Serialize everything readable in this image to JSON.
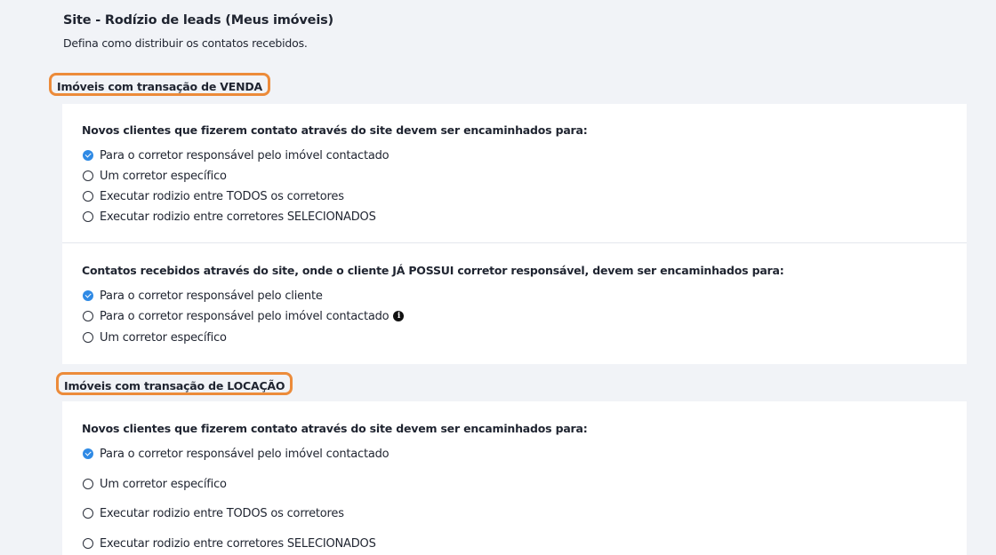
{
  "header": {
    "title": "Site - Rodízio de leads (Meus imóveis)",
    "subtitle": "Defina como distribuir os contatos recebidos."
  },
  "venda": {
    "title": "Imóveis com transação de VENDA",
    "novos": {
      "question": "Novos clientes que fizerem contato através do site devem ser encaminhados para:",
      "selected_index": 0,
      "options": [
        "Para o corretor responsável pelo imóvel contactado",
        "Um corretor específico",
        "Executar rodizio entre TODOS os corretores",
        "Executar rodizio entre corretores SELECIONADOS"
      ]
    },
    "existentes": {
      "question": "Contatos recebidos através do site, onde o cliente JÁ POSSUI corretor responsável, devem ser encaminhados para:",
      "selected_index": 0,
      "options": [
        "Para o corretor responsável pelo cliente",
        "Para o corretor responsável pelo imóvel contactado",
        "Um corretor específico"
      ],
      "info_icon": "info-icon"
    }
  },
  "locacao": {
    "title": "Imóveis com transação de LOCAÇÃO",
    "novos": {
      "question": "Novos clientes que fizerem contato através do site devem ser encaminhados para:",
      "selected_index": 0,
      "options": [
        "Para o corretor responsável pelo imóvel contactado",
        "Um corretor específico",
        "Executar rodizio entre TODOS os corretores",
        "Executar rodizio entre corretores SELECIONADOS"
      ]
    }
  },
  "colors": {
    "accent": "#2f8ae5",
    "highlight_border": "#ec8b3a",
    "background": "#f1f3f7"
  }
}
